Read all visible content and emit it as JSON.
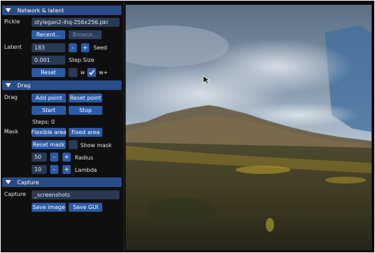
{
  "sections": {
    "network": "Network & latent",
    "drag": "Drag",
    "capture": "Capture"
  },
  "network": {
    "pickle_label": "Pickle",
    "pickle_value": "stylegan2-lhq-256x256.pkl",
    "recent_btn": "Recent...",
    "browse_btn": "Browse...",
    "latent_label": "Latent",
    "latent_value": "183",
    "minus": "-",
    "plus": "+",
    "seed_label": "Seed",
    "step_value": "0.001",
    "step_label": "Step Size",
    "reset_btn": "Reset",
    "w_label": "w",
    "wplus_label": "w+"
  },
  "drag": {
    "drag_label": "Drag",
    "add_point": "Add point",
    "reset_point": "Reset point",
    "start": "Start",
    "stop": "Stop",
    "steps": "Steps: 0",
    "mask_label": "Mask",
    "flexible_area": "Flexible area",
    "fixed_area": "Fixed area",
    "reset_mask": "Reset mask",
    "show_mask": "Show mask",
    "radius_value": "50",
    "radius_label": "Radius",
    "lambda_value": "10",
    "lambda_label": "Lambda"
  },
  "capture": {
    "capture_label": "Capture",
    "path_value": "_screenshots",
    "save_image": "Save image",
    "save_gui": "Save GUI"
  },
  "colors": {
    "header": "#2a4c86",
    "button": "#2b5aa6",
    "field": "#2a3a55",
    "panel": "#0f0f0f"
  }
}
